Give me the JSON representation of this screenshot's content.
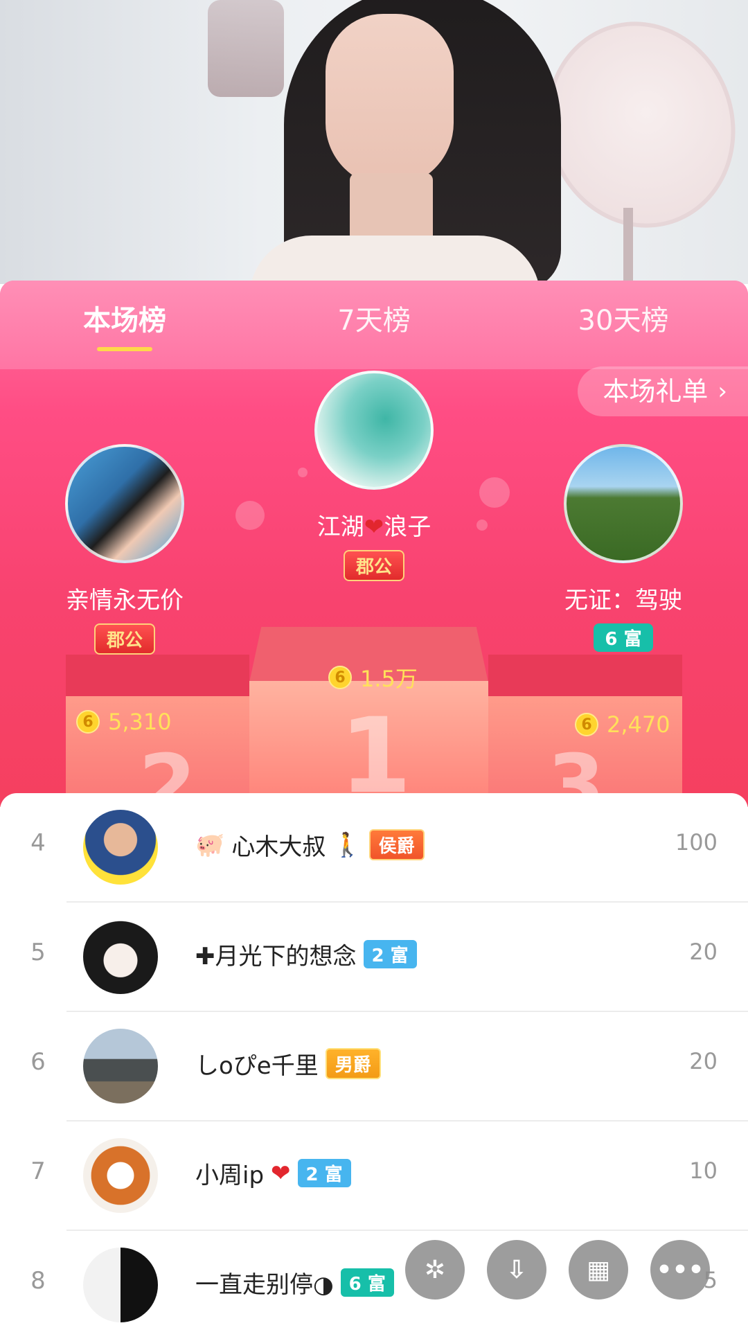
{
  "tabs": [
    {
      "label": "本场榜",
      "active": true
    },
    {
      "label": "7天榜",
      "active": false
    },
    {
      "label": "30天榜",
      "active": false
    }
  ],
  "gift_list": {
    "label": "本场礼单",
    "icon": "chevron-right-icon"
  },
  "top3": [
    {
      "rank": 1,
      "name_left": "江湖",
      "name_right": "浪子",
      "badge": "郡公",
      "amount": "1.5万",
      "coin_symbol": "6"
    },
    {
      "rank": 2,
      "name": "亲情永无价",
      "badge": "郡公",
      "amount": "5,310",
      "coin_symbol": "6"
    },
    {
      "rank": 3,
      "name": "无证：驾驶",
      "badge": "6 富",
      "amount": "2,470",
      "coin_symbol": "6"
    }
  ],
  "podium_numbers": {
    "first": "1",
    "second": "2",
    "third": "3"
  },
  "rows": [
    {
      "rank": "4",
      "name": "心木大叔",
      "badge": "侯爵",
      "score": "100"
    },
    {
      "rank": "5",
      "name": "✚月光下的想念",
      "badge": "2 富",
      "score": "20"
    },
    {
      "rank": "6",
      "name": "しoぴe千里",
      "badge": "男爵",
      "score": "20"
    },
    {
      "rank": "7",
      "name": "小周ip",
      "badge": "2 富",
      "score": "10"
    },
    {
      "rank": "8",
      "name": "一直走别停◑",
      "badge": "6 富",
      "score": "5"
    }
  ],
  "fab_buttons": [
    "share-icon",
    "download-icon",
    "grid-icon",
    "more-icon"
  ],
  "colors": {
    "accent_pink": "#ff4d84",
    "tab_underline": "#ffd84a",
    "coin": "#ffd42e",
    "rich2": "#47b5ef",
    "rich6": "#17bfa9"
  }
}
